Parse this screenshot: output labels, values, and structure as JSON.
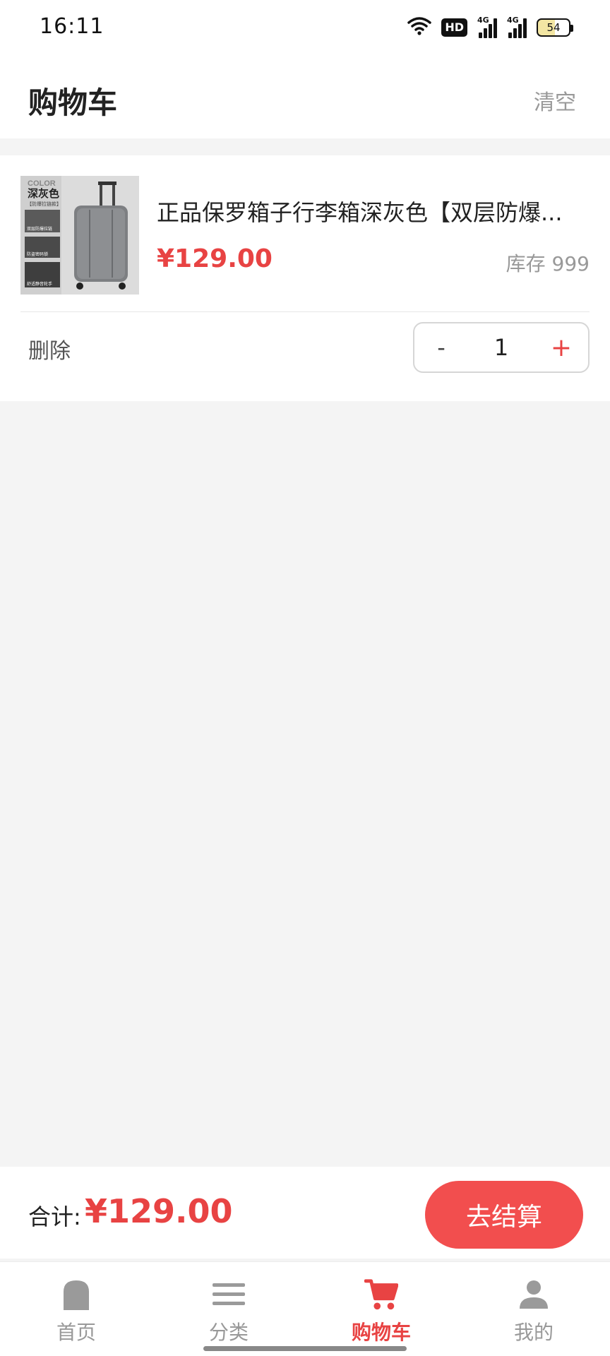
{
  "status_bar": {
    "time": "16:11",
    "network_badge": "HD",
    "network_type_1": "4G",
    "network_type_2": "4G",
    "battery_level": "54",
    "icons": [
      "wifi-icon",
      "hd-icon",
      "signal-4g-icon",
      "signal-4g-icon",
      "battery-icon"
    ]
  },
  "header": {
    "title": "购物车",
    "clear_label": "清空"
  },
  "cart": {
    "items": [
      {
        "name": "正品保罗箱子行李箱深灰色【双层防爆...",
        "price": "¥129.00",
        "stock": "库存 999",
        "delete_label": "删除",
        "quantity": "1",
        "minus_label": "-",
        "plus_label": "+",
        "thumbnail": {
          "color_word": "COLOR",
          "color_name": "深灰色",
          "subtitle": "【防爆拉链款】",
          "feature_1": "双层防爆拉链",
          "feature_2": "防盗密码锁",
          "feature_3": "舒适静音轮手"
        }
      }
    ]
  },
  "summary": {
    "total_label": "合计:",
    "total_value": "¥129.00",
    "checkout_label": "去结算"
  },
  "tabs": [
    {
      "label": "首页",
      "icon": "home-icon",
      "active": false
    },
    {
      "label": "分类",
      "icon": "menu-icon",
      "active": false
    },
    {
      "label": "购物车",
      "icon": "cart-icon",
      "active": true
    },
    {
      "label": "我的",
      "icon": "user-icon",
      "active": false
    }
  ],
  "colors": {
    "accent": "#e84343",
    "checkout_button": "#f24e4e",
    "muted_text": "#999999",
    "background": "#f4f4f4"
  }
}
